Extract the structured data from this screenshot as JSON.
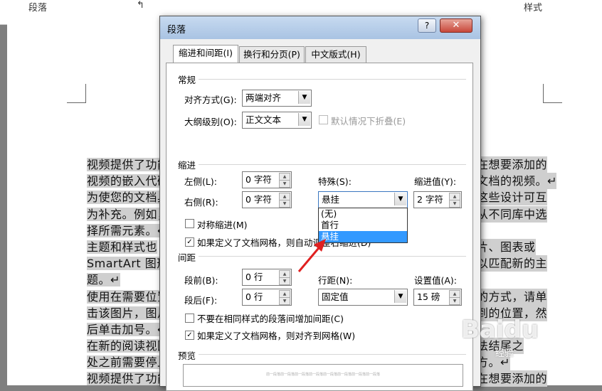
{
  "top_bar": {
    "left": "段落",
    "mid": "↰",
    "right": "样式"
  },
  "document": {
    "lines": [
      {
        "left": "视频提供了功能",
        "right": "在想要添加的"
      },
      {
        "left": "视频的嵌入代码",
        "right": "文档的视频。↵"
      },
      {
        "left": "为使您的文档具",
        "right": "这些设计可互"
      },
      {
        "left": "为补充。例如，",
        "right": "从不同库中选"
      },
      {
        "left": "择所需元素。↵",
        "right": ""
      },
      {
        "left": "主题和样式也",
        "right": "片、图表或"
      },
      {
        "left": "SmartArt 图形将",
        "right": "以匹配新的主"
      },
      {
        "left": "题。↵",
        "right": ""
      },
      {
        "left": "使用在需要位置",
        "right": "的方式，请单"
      },
      {
        "left": "击该图片，图片",
        "right": "到的位置，然"
      },
      {
        "left": "后单击加号。↵",
        "right": ""
      },
      {
        "left": "在新的阅读视图",
        "right": "法结尾之"
      },
      {
        "left": "处之前需要停止",
        "right": "方。↵"
      },
      {
        "left": "视频提供了功能",
        "right": "在想要添加的"
      }
    ]
  },
  "dialog": {
    "title": "段落",
    "help": "?",
    "close": "✕",
    "tabs": [
      {
        "label": "缩进和间距(I)"
      },
      {
        "label": "换行和分页(P)"
      },
      {
        "label": "中文版式(H)"
      }
    ],
    "general": {
      "title": "常规",
      "align_label": "对齐方式(G):",
      "align_value": "两端对齐",
      "outline_label": "大纲级别(O):",
      "outline_value": "正文文本",
      "collapse_label": "默认情况下折叠(E)"
    },
    "indent": {
      "title": "缩进",
      "left_label": "左侧(L):",
      "left_value": "0 字符",
      "right_label": "右侧(R):",
      "right_value": "0 字符",
      "special_label": "特殊(S):",
      "special_value": "悬挂",
      "indent_by_label": "缩进值(Y):",
      "indent_by_value": "2 字符",
      "mirror_label": "对称缩进(M)",
      "grid_label": "如果定义了文档网格，则自动调整右缩进(D)",
      "dropdown_options": [
        "(无)",
        "首行",
        "悬挂"
      ],
      "dropdown_selected": "悬挂"
    },
    "spacing": {
      "title": "间距",
      "before_label": "段前(B):",
      "before_value": "0 行",
      "after_label": "段后(F):",
      "after_value": "0 行",
      "line_label": "行距(N):",
      "line_value": "固定值",
      "at_label": "设置值(A):",
      "at_value": "15 磅",
      "no_space_label": "不要在相同样式的段落间增加间距(C)",
      "snap_label": "如果定义了文档网格，则对齐到网格(W)"
    },
    "preview": {
      "title": "预览",
      "text": "前一段落前一段落前一段落前一段落前一段落前一段落前一段落前一段落"
    }
  },
  "watermark": {
    "text": "Baidu",
    "sub": "经验"
  },
  "colors": {
    "selection": "#3399ff",
    "arrow": "#e02020",
    "title_bar": "#b6cdea"
  }
}
